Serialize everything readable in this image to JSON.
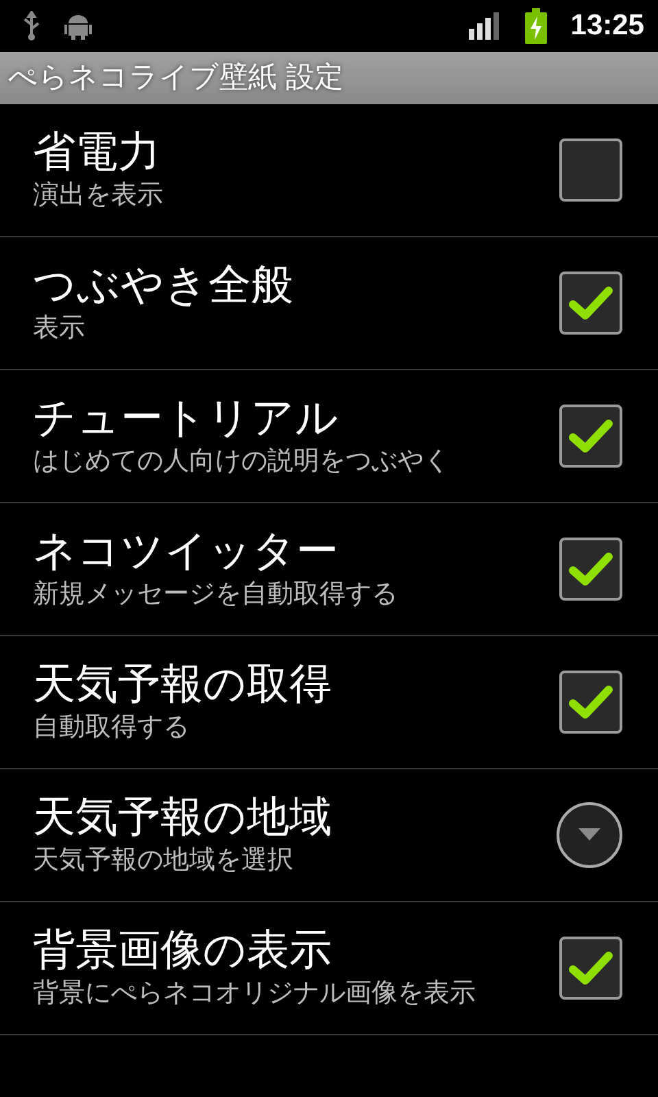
{
  "status_bar": {
    "time": "13:25"
  },
  "title_bar": {
    "title": "ぺらネコライブ壁紙 設定"
  },
  "settings": [
    {
      "kind": "checkbox",
      "title": "省電力",
      "summary": "演出を表示",
      "checked": false
    },
    {
      "kind": "checkbox",
      "title": "つぶやき全般",
      "summary": "表示",
      "checked": true
    },
    {
      "kind": "checkbox",
      "title": "チュートリアル",
      "summary": "はじめての人向けの説明をつぶやく",
      "checked": true
    },
    {
      "kind": "checkbox",
      "title": "ネコツイッター",
      "summary": "新規メッセージを自動取得する",
      "checked": true
    },
    {
      "kind": "checkbox",
      "title": "天気予報の取得",
      "summary": "自動取得する",
      "checked": true
    },
    {
      "kind": "dropdown",
      "title": "天気予報の地域",
      "summary": "天気予報の地域を選択"
    },
    {
      "kind": "checkbox",
      "title": "背景画像の表示",
      "summary": "背景にぺらネコオリジナル画像を表示",
      "checked": true
    }
  ]
}
